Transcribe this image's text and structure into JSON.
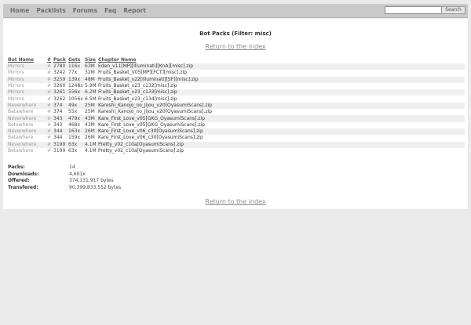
{
  "nav": {
    "items": [
      "Home",
      "Packlists",
      "Forums",
      "Faq",
      "Report"
    ]
  },
  "search": {
    "value": "",
    "placeholder": "",
    "button_label": "Search"
  },
  "page": {
    "title": "Bot Packs (Filter: misc)",
    "return_link": "Return to the index"
  },
  "table": {
    "headers": [
      "Bot Name",
      "#",
      "Pack",
      "Gets",
      "Size",
      "Chapter Name"
    ],
    "rows": [
      {
        "bot": "Mirrors",
        "hash": "#",
        "pack": "2780",
        "gets": "116x",
        "size": "63M",
        "chapter": "Eden_v11[MP][Illuminati][KnA][misc].zip"
      },
      {
        "bot": "Mirrors",
        "hash": "#",
        "pack": "3242",
        "gets": "77x",
        "size": "32M",
        "chapter": "Fruits_Basket_V05[MP][FCT][misc].zip"
      },
      {
        "bot": "Mirrors",
        "hash": "#",
        "pack": "3259",
        "gets": "139x",
        "size": "48M",
        "chapter": "Fruits_Basket_v22[Illuminati][SF][misc].zip"
      },
      {
        "bot": "Mirrors",
        "hash": "#",
        "pack": "3260",
        "gets": "1248x",
        "size": "5.9M",
        "chapter": "Fruits_Basket_v23_c132[misc].zip"
      },
      {
        "bot": "Mirrors",
        "hash": "#",
        "pack": "3261",
        "gets": "556x",
        "size": "6.2M",
        "chapter": "Fruits_Basket_v23_c133[misc].zip"
      },
      {
        "bot": "Mirrors",
        "hash": "#",
        "pack": "3262",
        "gets": "1056x",
        "size": "6.5M",
        "chapter": "Fruits_Basket_v23_c134[misc].zip"
      },
      {
        "bot": "Neverwhere",
        "hash": "#",
        "pack": "374",
        "gets": "49x",
        "size": "25M",
        "chapter": "Kareshi_Kanojo_no_Jijou_v20[OyasumiScans].zip"
      },
      {
        "bot": "Betawhere",
        "hash": "#",
        "pack": "374",
        "gets": "55x",
        "size": "25M",
        "chapter": "Kareshi_Kanojo_no_Jijou_v20[OyasumiScans].zip"
      },
      {
        "bot": "Neverwhere",
        "hash": "#",
        "pack": "343",
        "gets": "479x",
        "size": "43M",
        "chapter": "Kare_First_Love_v05[GKG_OyasumiScans].zip"
      },
      {
        "bot": "Betawhere",
        "hash": "#",
        "pack": "343",
        "gets": "468x",
        "size": "43M",
        "chapter": "Kare_First_Love_v05[GKG_OyasumiScans].zip"
      },
      {
        "bot": "Neverwhere",
        "hash": "#",
        "pack": "344",
        "gets": "163x",
        "size": "26M",
        "chapter": "Kare_First_Love_v06_c30[OyasumiScans].zip"
      },
      {
        "bot": "Betawhere",
        "hash": "#",
        "pack": "344",
        "gets": "159x",
        "size": "26M",
        "chapter": "Kare_First_Love_v06_c30[OyasumiScans].zip"
      },
      {
        "bot": "Neverwhere",
        "hash": "#",
        "pack": "3199",
        "gets": "63x",
        "size": "4.1M",
        "chapter": "Pretty_v02_c10a[OyasumiScans].zip"
      },
      {
        "bot": "Betawhere",
        "hash": "#",
        "pack": "3199",
        "gets": "63x",
        "size": "4.1M",
        "chapter": "Pretty_v02_c10a[OyasumiScans].zip"
      }
    ]
  },
  "stats": [
    {
      "label": "Packs:",
      "value": "14"
    },
    {
      "label": "Downloads:",
      "value": "4,691x"
    },
    {
      "label": "Offered:",
      "value": "374,131,917 bytes"
    },
    {
      "label": "Transfered:",
      "value": "90,399,833,552 bytes"
    }
  ]
}
